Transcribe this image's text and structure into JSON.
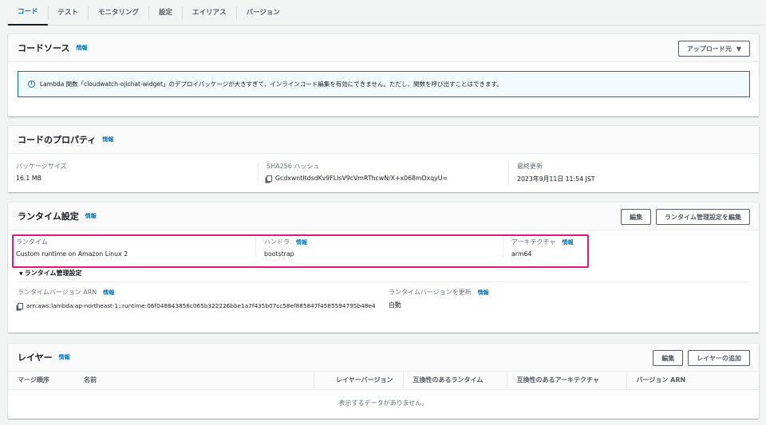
{
  "tabs": [
    "コード",
    "テスト",
    "モニタリング",
    "設定",
    "エイリアス",
    "バージョン"
  ],
  "info": "情報",
  "code_source": {
    "title": "コードソース",
    "upload_button": "アップロード元",
    "alert": "Lambda 関数「cloudwatch-ojichat-widget」のデプロイパッケージが大きすぎて、インラインコード編集を有効にできません。ただし、関数を呼び出すことはできます。"
  },
  "code_props": {
    "title": "コードのプロパティ",
    "package_size_label": "パッケージサイズ",
    "package_size": "16.1 MB",
    "sha_label": "SHA256 ハッシュ",
    "sha": "GcdxwntItdsdKv9FLIsV9cVmRThcwN/X+x068mDxqyU=",
    "updated_label": "最終更新",
    "updated": "2023年9月11日 11:54 JST"
  },
  "runtime": {
    "title": "ランタイム設定",
    "edit": "編集",
    "edit_mgmt": "ランタイム管理設定を編集",
    "runtime_label": "ランタイム",
    "runtime": "Custom runtime on Amazon Linux 2",
    "handler_label": "ハンドラ",
    "handler": "bootstrap",
    "arch_label": "アーキテクチャ",
    "arch": "arm64",
    "mgmt_title": "ランタイム管理設定",
    "arn_label": "ランタイムバージョン ARN",
    "arn": "arn:aws:lambda:ap-northeast-1::runtime:06f048843856c065b322226bbe1a7f435b07cc58ef885847f4585594795b48e4",
    "update_label": "ランタイムバージョンを更新",
    "update": "自動"
  },
  "layers": {
    "title": "レイヤー",
    "edit": "編集",
    "add": "レイヤーの追加",
    "columns": [
      "マージ順序",
      "名前",
      "レイヤーバージョン",
      "互換性のあるランタイム",
      "互換性のあるアーキテクチャ",
      "バージョン ARN"
    ],
    "empty": "表示するデータがありません。"
  },
  "colors": {
    "accent": "#0073bb",
    "highlight": "#e7157b"
  }
}
